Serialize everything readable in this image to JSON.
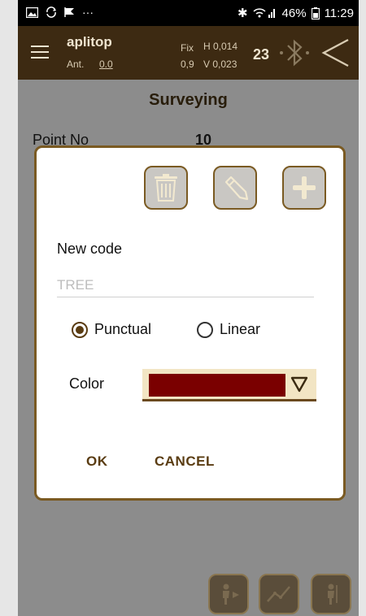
{
  "status_bar": {
    "left_icons": [
      "gallery-icon",
      "sync-icon",
      "flag-icon",
      "more-icon"
    ],
    "more": "···",
    "bluetooth": "✱",
    "battery_pct": "46%",
    "time": "11:29"
  },
  "app_bar": {
    "title": "aplitop",
    "ant_label": "Ant.",
    "ant_value": "0.0",
    "fix_label": "Fix",
    "h_label_value": "H 0,014",
    "hz_value": "0,9",
    "v_label_value": "V 0,023",
    "satellites": "23"
  },
  "screen": {
    "heading": "Surveying",
    "point_no_label": "Point No",
    "point_no_value": "10"
  },
  "dialog": {
    "buttons": [
      "delete",
      "edit",
      "add"
    ],
    "new_code_label": "New code",
    "code_placeholder": "TREE",
    "code_value": "",
    "radio_punctual": "Punctual",
    "radio_linear": "Linear",
    "selected_type": "Punctual",
    "color_label": "Color",
    "selected_color": "#7a0000",
    "ok_label": "OK",
    "cancel_label": "CANCEL"
  },
  "colors": {
    "appbar": "#3d2a12",
    "accent": "#5a3c12",
    "dropdown_bg": "#f2e5c4"
  }
}
